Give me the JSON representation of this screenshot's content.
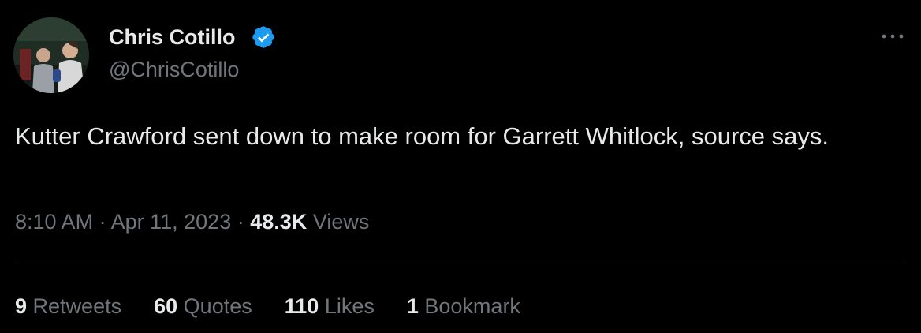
{
  "author": {
    "display_name": "Chris Cotillo",
    "handle": "@ChrisCotillo",
    "verified": true,
    "verified_color": "#1d9bf0"
  },
  "tweet": {
    "text": "Kutter Crawford sent down to make room for Garrett Whitlock, source says.",
    "time": "8:10 AM",
    "separator": "·",
    "date": "Apr 11, 2023",
    "views_count": "48.3K",
    "views_label": "Views"
  },
  "stats": {
    "retweets": {
      "count": "9",
      "label": "Retweets"
    },
    "quotes": {
      "count": "60",
      "label": "Quotes"
    },
    "likes": {
      "count": "110",
      "label": "Likes"
    },
    "bookmarks": {
      "count": "1",
      "label": "Bookmark"
    }
  },
  "icons": {
    "more": "more-icon",
    "verified": "verified-badge-icon"
  },
  "colors": {
    "background": "#000000",
    "primary_text": "#e7e9ea",
    "secondary_text": "#71767b",
    "divider": "#2f3336"
  }
}
